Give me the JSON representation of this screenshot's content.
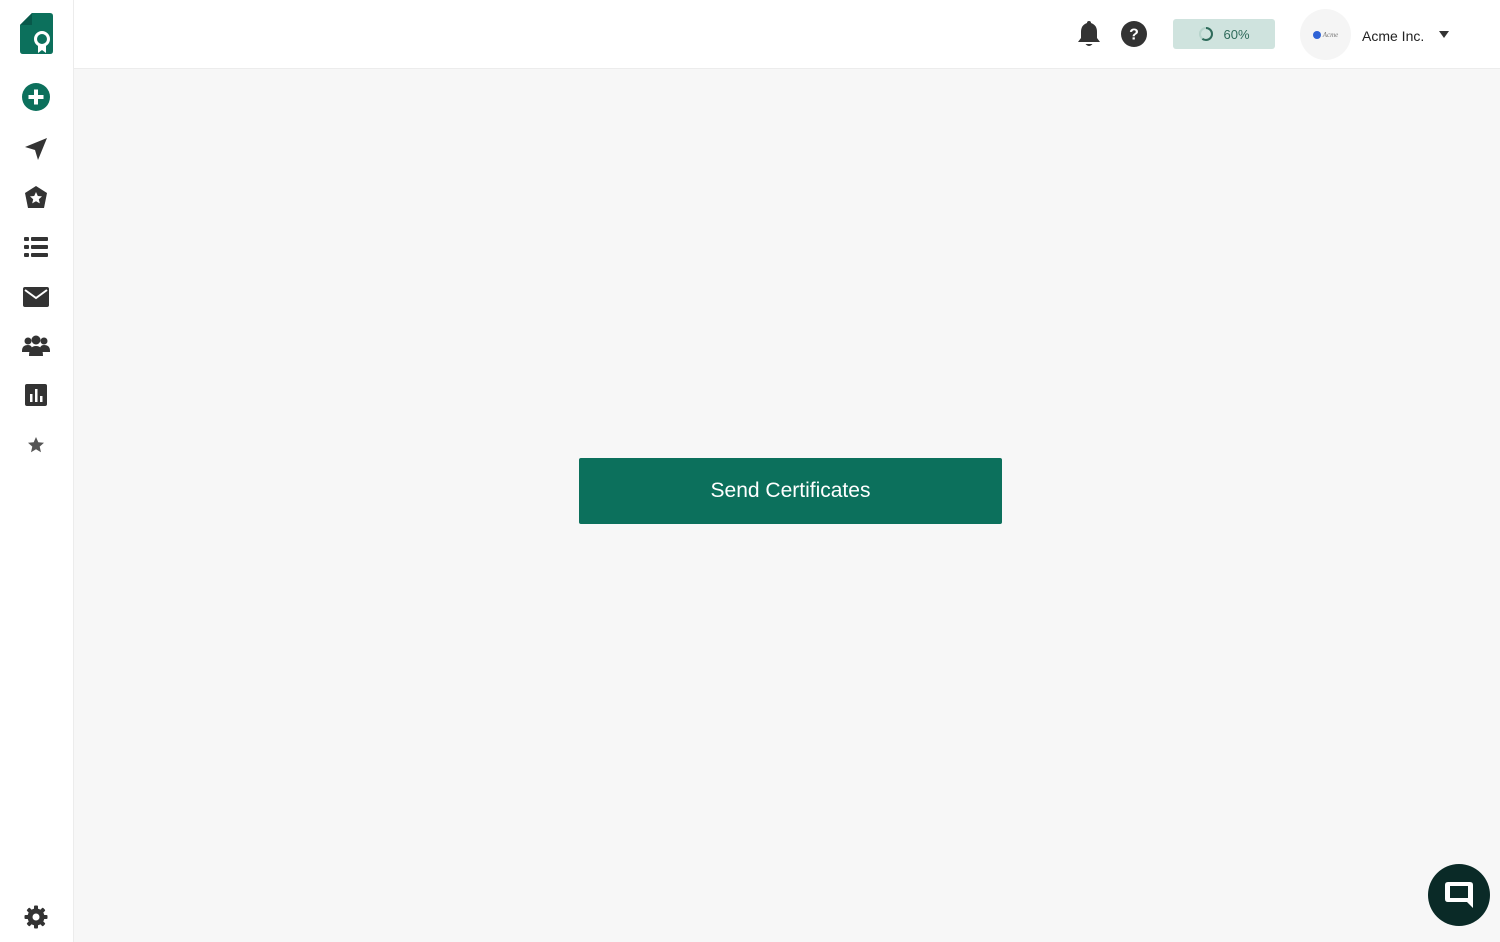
{
  "brand": {
    "accent_color": "#0c705c",
    "logo_icon": "certificate-logo-icon"
  },
  "sidebar": {
    "items": [
      {
        "icon": "plus-circle-icon",
        "name": "create"
      },
      {
        "icon": "paper-plane-icon",
        "name": "send"
      },
      {
        "icon": "badge-star-icon",
        "name": "badges"
      },
      {
        "icon": "list-icon",
        "name": "list"
      },
      {
        "icon": "envelope-icon",
        "name": "email"
      },
      {
        "icon": "users-icon",
        "name": "users"
      },
      {
        "icon": "bar-chart-icon",
        "name": "analytics"
      },
      {
        "icon": "star-icon",
        "name": "favorites"
      }
    ],
    "footer_icon": "gear-icon"
  },
  "header": {
    "notification_icon": "bell-icon",
    "help_icon": "question-circle-icon",
    "progress": {
      "value": 0.6,
      "label": "60%"
    },
    "organization": {
      "avatar_text": "Acme",
      "name": "Acme Inc."
    }
  },
  "main": {
    "primary_action_label": "Send Certificates"
  },
  "chat": {
    "icon": "chat-bubble-icon"
  }
}
